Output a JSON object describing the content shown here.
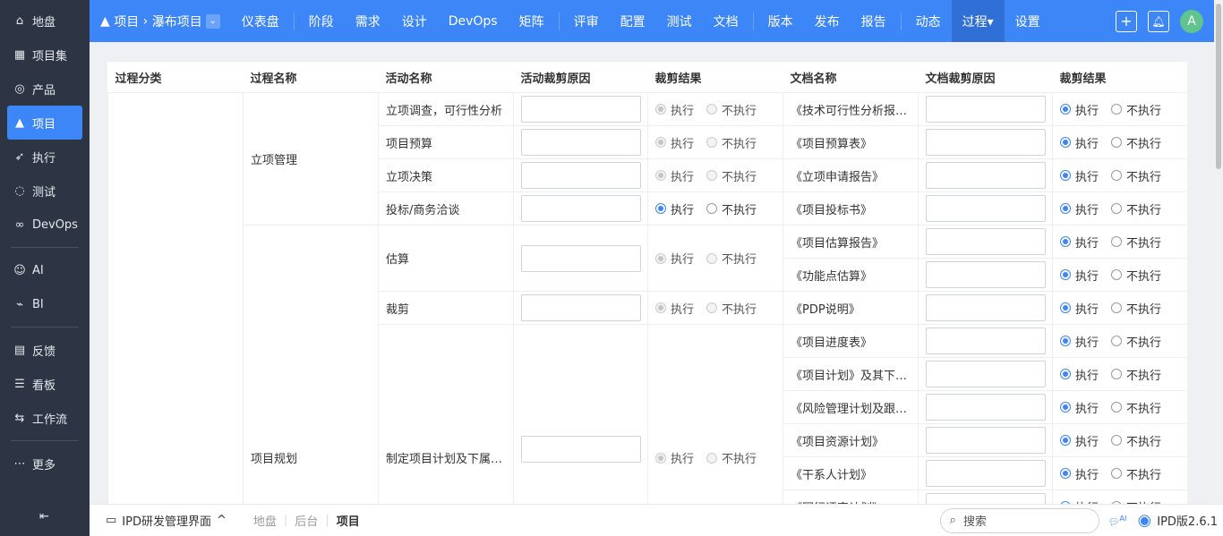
{
  "sidebar": {
    "items": [
      {
        "label": "地盘",
        "icon": "home-icon",
        "glyph": "⌂"
      },
      {
        "label": "项目集",
        "icon": "grid-icon",
        "glyph": "▦"
      },
      {
        "label": "产品",
        "icon": "bulb-icon",
        "glyph": "◎"
      },
      {
        "label": "项目",
        "icon": "rocket-icon",
        "glyph": "▲",
        "active": true
      },
      {
        "label": "执行",
        "icon": "run-icon",
        "glyph": "➶"
      },
      {
        "label": "测试",
        "icon": "test-icon",
        "glyph": "◌"
      },
      {
        "label": "DevOps",
        "icon": "infinity-icon",
        "glyph": "∞"
      },
      {
        "sep": true
      },
      {
        "label": "AI",
        "icon": "robot-icon",
        "glyph": "☺"
      },
      {
        "label": "BI",
        "icon": "chart-icon",
        "glyph": "⌁"
      },
      {
        "sep": true
      },
      {
        "label": "反馈",
        "icon": "feedback-icon",
        "glyph": "▤"
      },
      {
        "label": "看板",
        "icon": "kanban-icon",
        "glyph": "☰"
      },
      {
        "label": "工作流",
        "icon": "workflow-icon",
        "glyph": "⇆"
      },
      {
        "sep": true
      },
      {
        "label": "更多",
        "icon": "more-icon",
        "glyph": "⋯"
      }
    ],
    "collapse_glyph": "⇤"
  },
  "topbar": {
    "breadcrumb_root": "项目",
    "breadcrumb_current": "瀑布项目",
    "nav": [
      [
        "仪表盘"
      ],
      [
        "|"
      ],
      [
        "阶段"
      ],
      [
        "需求"
      ],
      [
        "设计"
      ],
      [
        "DevOps"
      ],
      [
        "矩阵"
      ],
      [
        "|"
      ],
      [
        "评审"
      ],
      [
        "配置"
      ],
      [
        "测试"
      ],
      [
        "文档"
      ],
      [
        "|"
      ],
      [
        "版本"
      ],
      [
        "发布"
      ],
      [
        "报告"
      ],
      [
        "|"
      ],
      [
        "动态"
      ],
      [
        "过程▾",
        "active"
      ],
      [
        "设置"
      ]
    ],
    "avatar": "A",
    "accent": "#3c86f7"
  },
  "table": {
    "headers": [
      "过程分类",
      "过程名称",
      "活动名称",
      "活动裁剪原因",
      "裁剪结果",
      "文档名称",
      "文档裁剪原因",
      "裁剪结果"
    ],
    "yes": "执行",
    "no": "不执行",
    "processes": [
      {
        "name": "立项管理",
        "start": 0,
        "span": 4
      },
      {
        "name": "项目规划",
        "start": 4,
        "span": 9,
        "offset": true
      }
    ],
    "activities": [
      {
        "name": "立项调查，可行性分析",
        "start": 0,
        "span": 1,
        "enabled": false
      },
      {
        "name": "项目预算",
        "start": 1,
        "span": 1,
        "enabled": false
      },
      {
        "name": "立项决策",
        "start": 2,
        "span": 1,
        "enabled": false
      },
      {
        "name": "投标/商务洽谈",
        "start": 3,
        "span": 1,
        "enabled": true
      },
      {
        "name": "估算",
        "start": 4,
        "span": 2,
        "enabled": false
      },
      {
        "name": "裁剪",
        "start": 6,
        "span": 1,
        "enabled": false
      },
      {
        "name": "制定项目计划及下属计划",
        "start": 7,
        "span": 6,
        "enabled": false,
        "offset": true
      }
    ],
    "documents": [
      "《技术可行性分析报告》",
      "《项目预算表》",
      "《立项申请报告》",
      "《项目投标书》",
      "《项目估算报告》",
      "《功能点估算》",
      "《PDP说明》",
      "《项目进度表》",
      "《项目计划》及其下属计划",
      "《风险管理计划及跟踪表》",
      "《项目资源计划》",
      "《干系人计划》",
      "《同行评审计划》"
    ]
  },
  "footer": {
    "app": "IPD研发管理界面",
    "crumbs": [
      "地盘",
      "后台"
    ],
    "current": "项目",
    "search_placeholder": "搜索",
    "version": "IPD版2.6.1",
    "ai": "AI"
  }
}
